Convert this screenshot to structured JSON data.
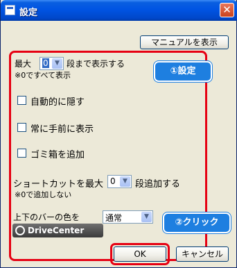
{
  "window": {
    "title": "設定",
    "close_glyph": "✕"
  },
  "toolbar": {
    "manual_button": "マニュアルを表示"
  },
  "settings": {
    "max_rows_prefix": "最大",
    "max_rows_value": "0",
    "max_rows_suffix": "段まで表示する",
    "max_rows_note": "※0ですべて表示",
    "auto_hide_label": "自動的に隠す",
    "auto_hide_checked": false,
    "always_on_top_label": "常に手前に表示",
    "always_on_top_checked": false,
    "trash_label": "ゴミ箱を追加",
    "trash_checked": false,
    "shortcut_prefix": "ショートカットを最大",
    "shortcut_value": "0",
    "shortcut_suffix": "段追加する",
    "shortcut_note": "※0で追加しない",
    "bar_color_label": "上下のバーの色を",
    "bar_color_value": "通常"
  },
  "branding": {
    "logo_text": "DriveCenter"
  },
  "annotations": {
    "callout_settings": "①設定",
    "callout_click": "②クリック"
  },
  "footer": {
    "ok_label": "OK",
    "cancel_label": "キャンセル"
  },
  "icons": {
    "dropdown_arrow": "▼"
  },
  "colors": {
    "highlight_red": "#e60012",
    "callout_blue": "#1e7fe0"
  }
}
